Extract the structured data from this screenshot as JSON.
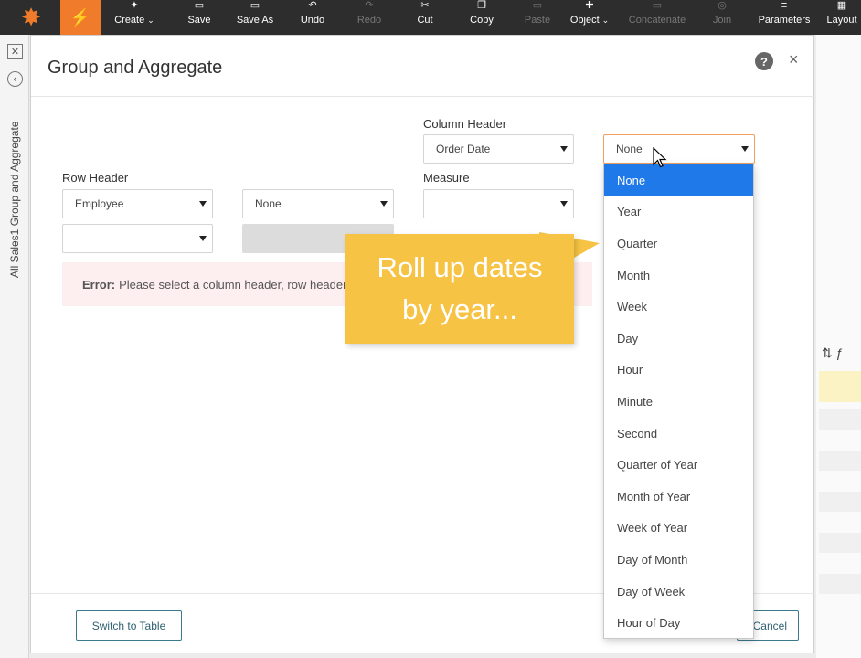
{
  "toolbar": {
    "items": [
      {
        "label": "Create",
        "icon": "create-icon",
        "disabled": false,
        "has_menu": true
      },
      {
        "label": "Save",
        "icon": "save-icon",
        "disabled": false,
        "has_menu": false
      },
      {
        "label": "Save As",
        "icon": "save-as-icon",
        "disabled": false,
        "has_menu": false
      },
      {
        "label": "Undo",
        "icon": "undo-icon",
        "disabled": false,
        "has_menu": false
      },
      {
        "label": "Redo",
        "icon": "redo-icon",
        "disabled": true,
        "has_menu": false
      },
      {
        "label": "Cut",
        "icon": "cut-icon",
        "disabled": false,
        "has_menu": false
      },
      {
        "label": "Copy",
        "icon": "copy-icon",
        "disabled": false,
        "has_menu": false
      },
      {
        "label": "Paste",
        "icon": "paste-icon",
        "disabled": true,
        "has_menu": false
      },
      {
        "label": "Object",
        "icon": "object-icon",
        "disabled": false,
        "has_menu": true
      },
      {
        "label": "Concatenate",
        "icon": "concatenate-icon",
        "disabled": true,
        "has_menu": false
      },
      {
        "label": "Join",
        "icon": "join-icon",
        "disabled": true,
        "has_menu": false
      },
      {
        "label": "Parameters",
        "icon": "parameters-icon",
        "disabled": false,
        "has_menu": false
      },
      {
        "label": "Layout",
        "icon": "layout-icon",
        "disabled": false,
        "has_menu": false
      }
    ]
  },
  "left_panel": {
    "label": "All Sales1 Group and Aggregate"
  },
  "dialog": {
    "title": "Group and Aggregate",
    "column_header": {
      "label": "Column Header",
      "field_value": "Order Date",
      "grouping_value": "None"
    },
    "row_header": {
      "label": "Row Header",
      "field_value": "Employee",
      "grouping_value": "None",
      "second_field_value": ""
    },
    "measure": {
      "label": "Measure",
      "value": ""
    },
    "error": {
      "label": "Error:",
      "message": "Please select a column header, row header(s), and measure"
    },
    "buttons": {
      "switch_to_table": "Switch to Table",
      "cancel": "Cancel"
    }
  },
  "callout": {
    "line1": "Roll up dates",
    "line2": "by year..."
  },
  "dropdown": {
    "selected": "None",
    "options": [
      "None",
      "Year",
      "Quarter",
      "Month",
      "Week",
      "Day",
      "Hour",
      "Minute",
      "Second",
      "Quarter of Year",
      "Month of Year",
      "Week of Year",
      "Day of Month",
      "Day of Week",
      "Hour of Day"
    ]
  },
  "colors": {
    "toolbar_bg": "#2d2d2d",
    "accent_orange": "#f07c2b",
    "selected_blue": "#1f79e8",
    "callout_yellow": "#f6c344",
    "error_bg": "#fdeef0"
  }
}
